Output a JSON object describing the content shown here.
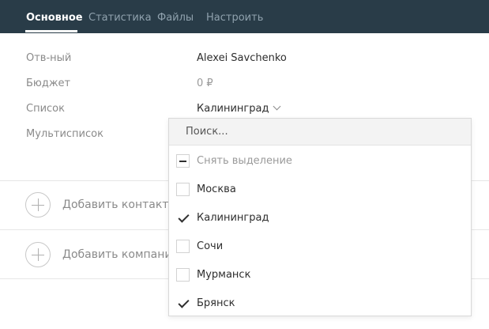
{
  "tabs": [
    {
      "label": "Основное",
      "active": true
    },
    {
      "label": "Статистика"
    },
    {
      "label": "Файлы"
    },
    {
      "label": "Настроить"
    }
  ],
  "fields": {
    "responsible": {
      "label": "Отв-ный",
      "value": "Alexei Savchenko"
    },
    "budget": {
      "label": "Бюджет",
      "value": "0 ₽"
    },
    "list": {
      "label": "Список",
      "value": "Калининград",
      "icon": "chevron-down-icon"
    },
    "multilist": {
      "label": "Мультисписок"
    }
  },
  "actions": {
    "add_contact": {
      "label": "Добавить контакт",
      "icon": "plus-circle-icon"
    },
    "add_company": {
      "label": "Добавить компани",
      "icon": "plus-circle-icon"
    }
  },
  "dropdown": {
    "search_placeholder": "Поиск...",
    "deselect_label": "Снять выделение",
    "options": [
      {
        "label": "Москва",
        "checked": false
      },
      {
        "label": "Калининград",
        "checked": true
      },
      {
        "label": "Сочи",
        "checked": false
      },
      {
        "label": "Мурманск",
        "checked": false
      },
      {
        "label": "Брянск",
        "checked": true
      }
    ]
  },
  "colors": {
    "header_bg": "#293c48",
    "tab_inactive": "#8fa1ad",
    "tab_active": "#ffffff"
  }
}
